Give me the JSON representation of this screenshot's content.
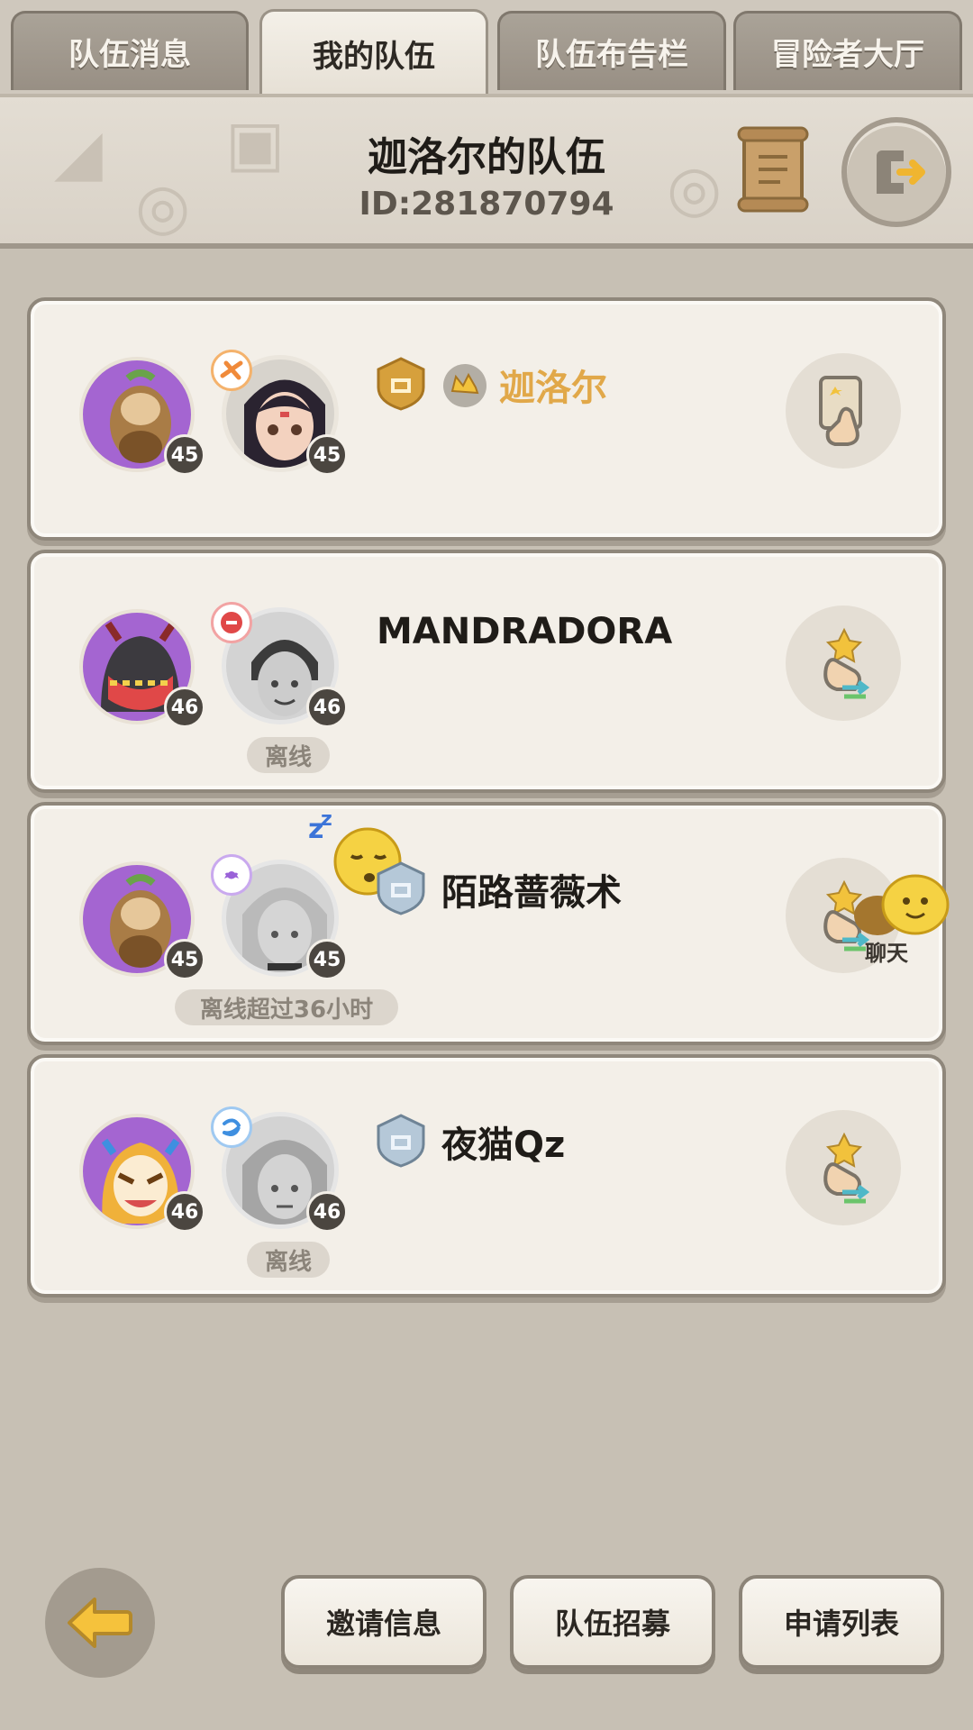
{
  "tabs": [
    {
      "label": "队伍消息",
      "active": false
    },
    {
      "label": "我的队伍",
      "active": true
    },
    {
      "label": "队伍布告栏",
      "active": false
    },
    {
      "label": "冒险者大厅",
      "active": false
    }
  ],
  "header": {
    "title": "迦洛尔的队伍",
    "id_text": "ID:281870794"
  },
  "members": [
    {
      "name": "迦洛尔",
      "pet_level": "45",
      "hero_level": "45",
      "status": "",
      "role": "leader",
      "class_color": "#f08a3a",
      "action_icon": "rules-hand-icon"
    },
    {
      "name": "MANDRADORA",
      "pet_level": "46",
      "hero_level": "46",
      "status": "离线",
      "role": "member",
      "class_color": "#e04848",
      "action_icon": "swap-hand-icon"
    },
    {
      "name": "陌路蔷薇术",
      "pet_level": "45",
      "hero_level": "45",
      "status": "离线超过36小时",
      "role": "member",
      "class_color": "#9a62d8",
      "action_icon": "swap-hand-icon"
    },
    {
      "name": "夜猫Qz",
      "pet_level": "46",
      "hero_level": "46",
      "status": "离线",
      "role": "member",
      "class_color": "#3f8fe0",
      "action_icon": "swap-hand-icon"
    }
  ],
  "chat_label": "聊天",
  "bottom": {
    "invite": "邀请信息",
    "recruit": "队伍招募",
    "applications": "申请列表"
  },
  "colors": {
    "leader_name": "#e1a849",
    "pet_bg": "#a465d1",
    "background": "#c7c0b4"
  }
}
